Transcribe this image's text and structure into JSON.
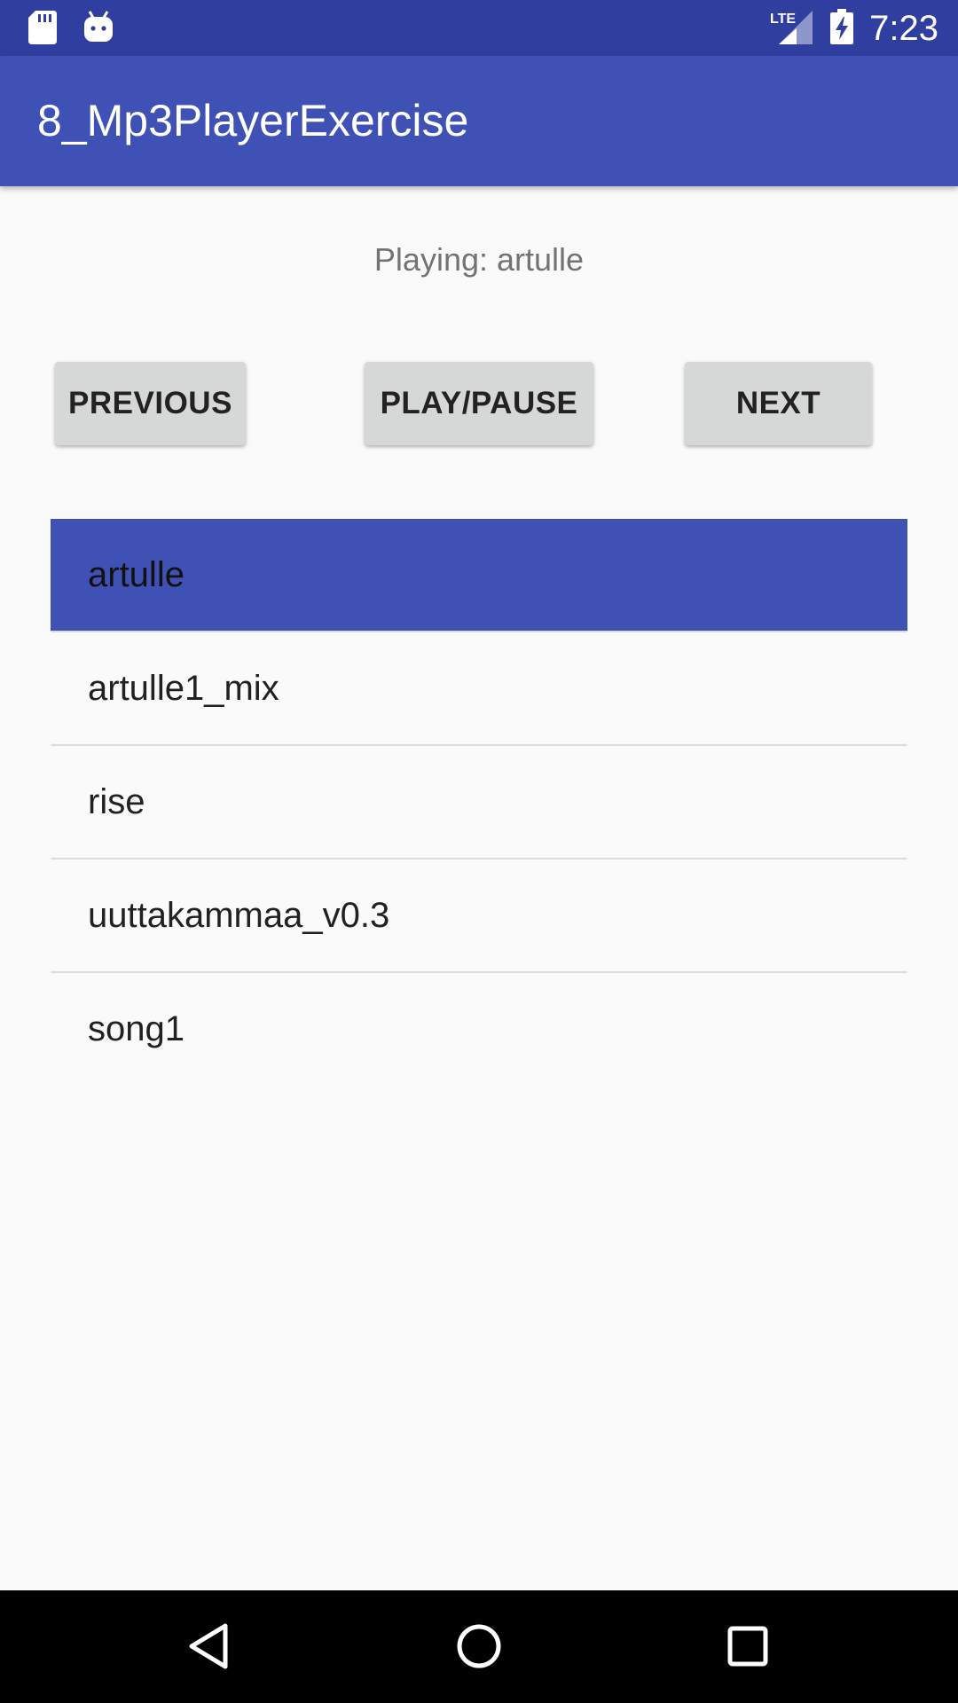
{
  "status_bar": {
    "time": "7:23",
    "network_label": "LTE",
    "icons": [
      "sd-card-icon",
      "android-debug-icon",
      "lte-signal-icon",
      "battery-charging-icon"
    ]
  },
  "app_bar": {
    "title": "8_Mp3PlayerExercise",
    "color": "#3f51b5"
  },
  "now_playing": {
    "text": "Playing: artulle"
  },
  "controls": {
    "previous_label": "PREVIOUS",
    "play_pause_label": "PLAY/PAUSE",
    "next_label": "NEXT"
  },
  "tracks": [
    {
      "title": "artulle",
      "selected": true
    },
    {
      "title": "artulle1_mix",
      "selected": false
    },
    {
      "title": "rise",
      "selected": false
    },
    {
      "title": "uuttakammaa_v0.3",
      "selected": false
    },
    {
      "title": "song1",
      "selected": false
    }
  ],
  "nav_bar": {
    "icons": [
      "back-icon",
      "home-icon",
      "recents-icon"
    ]
  }
}
